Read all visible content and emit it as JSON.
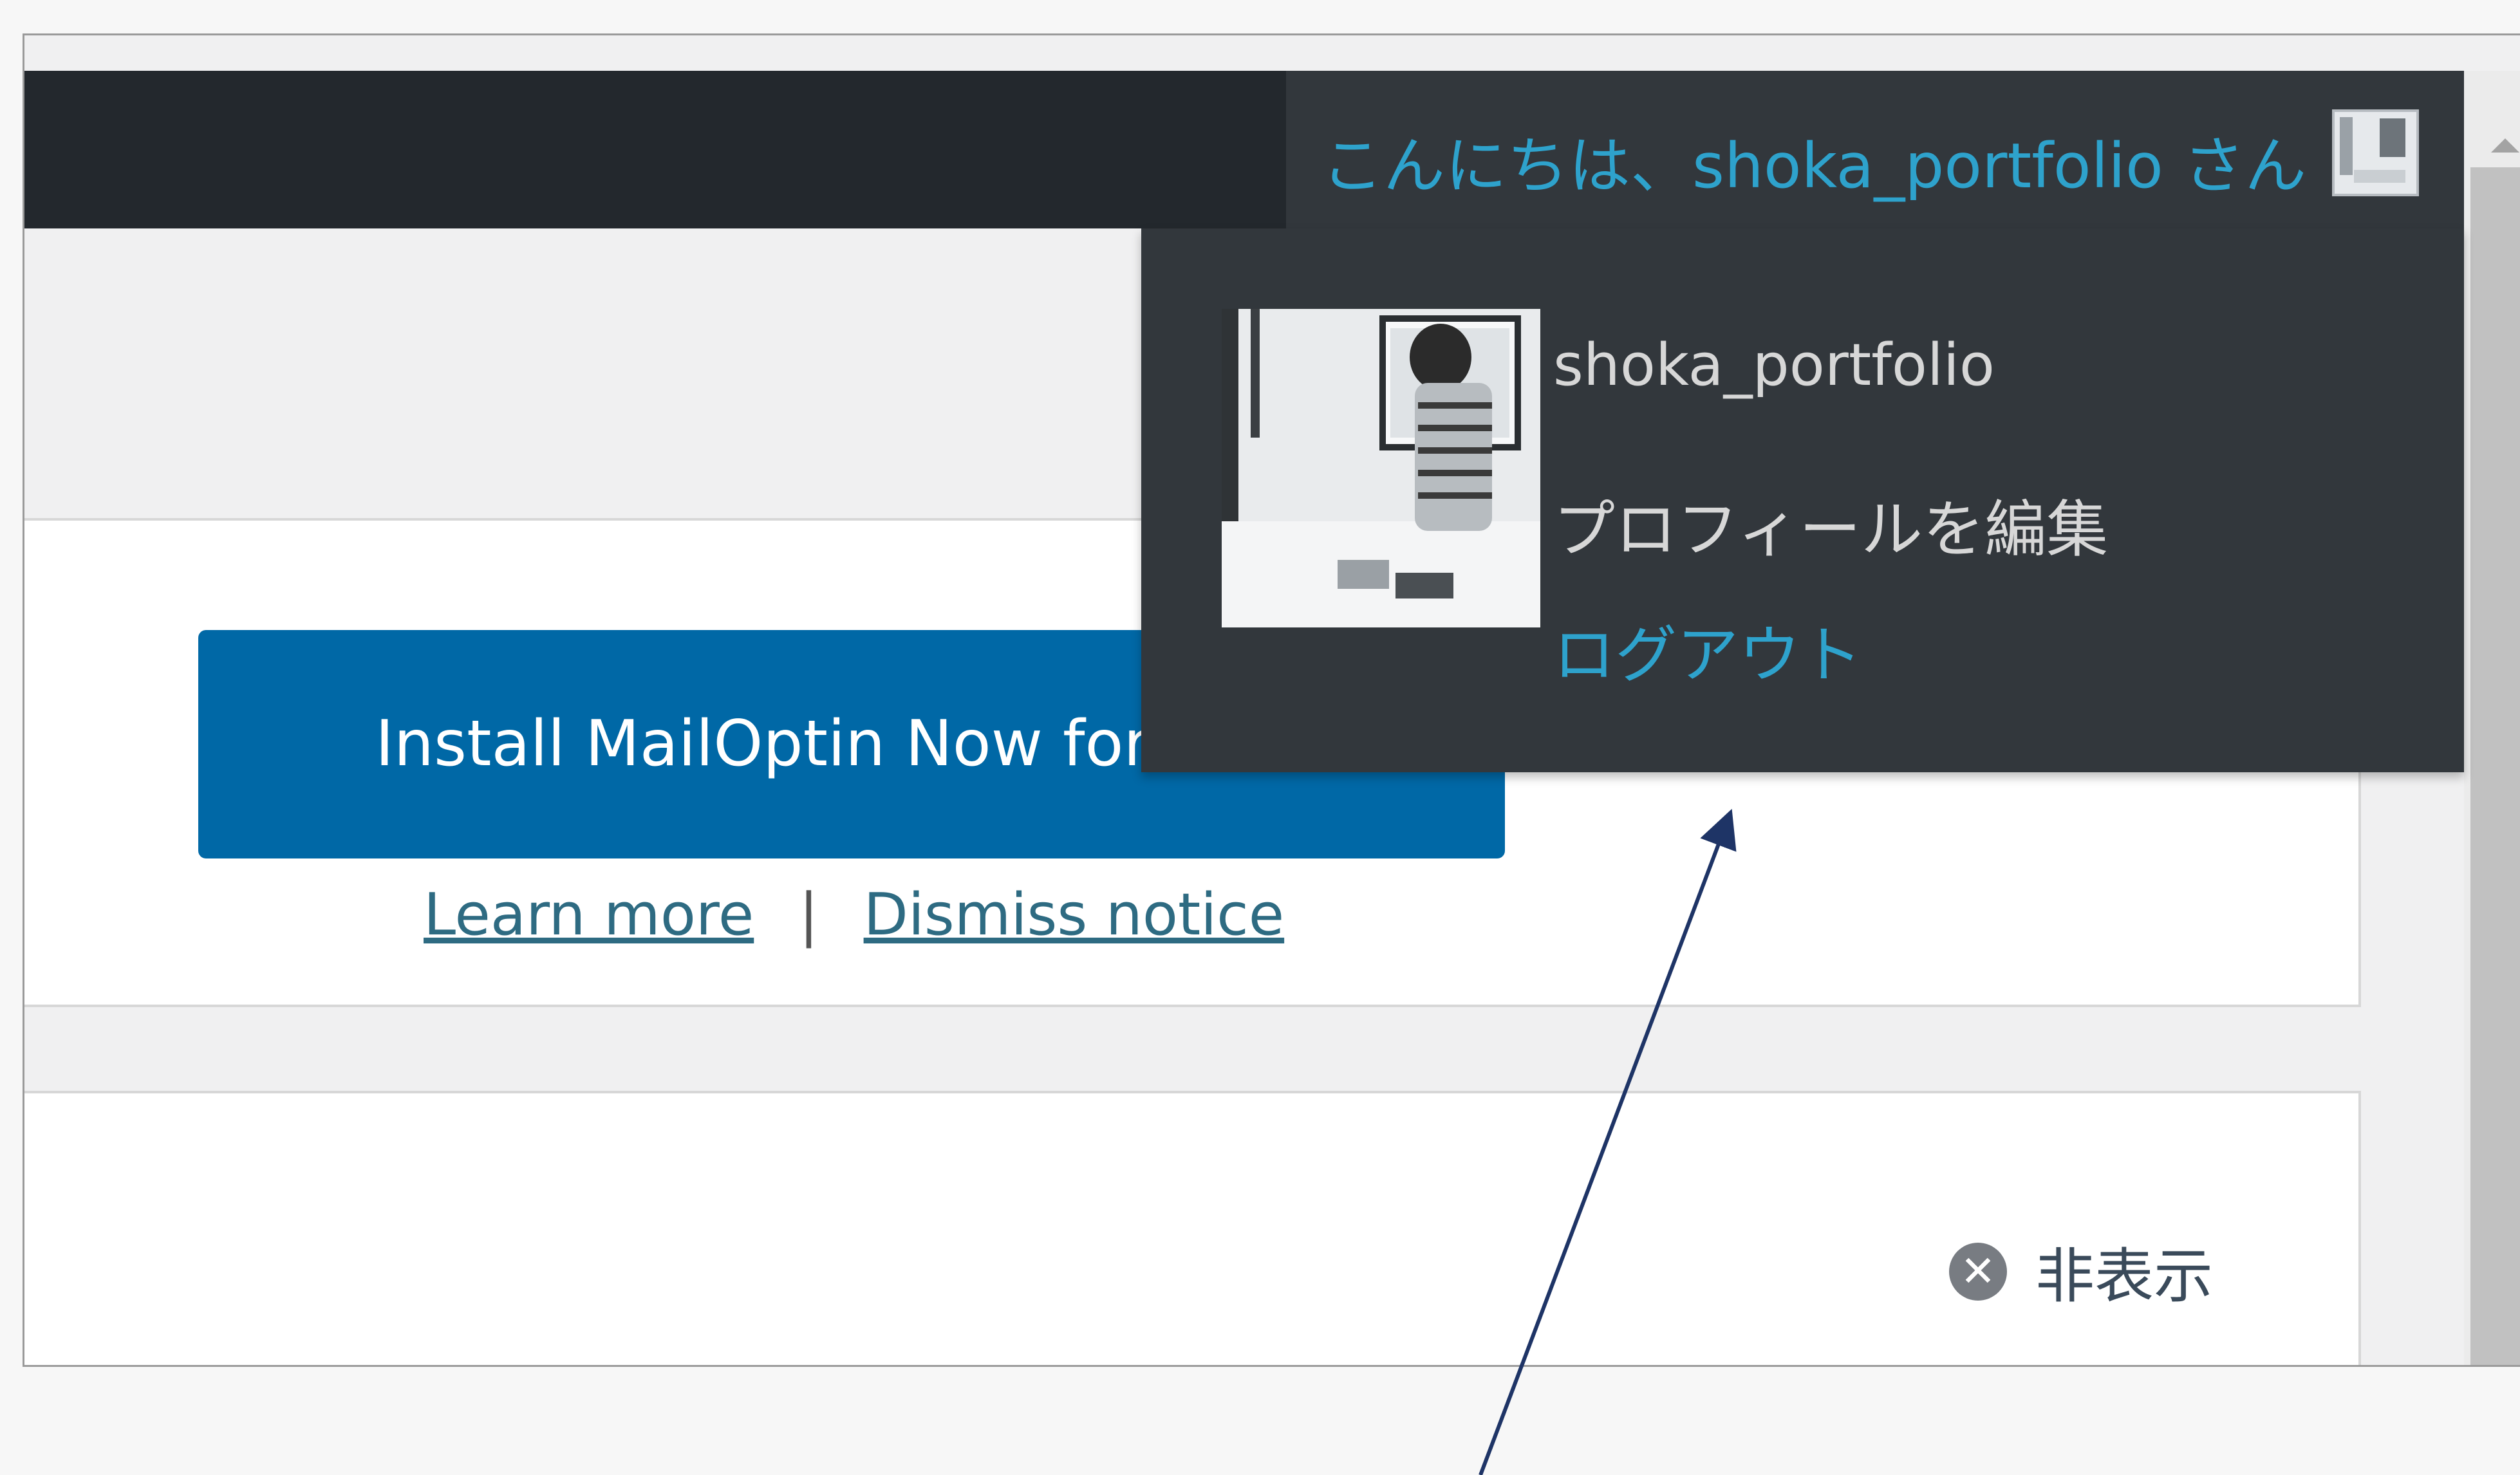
{
  "admin_bar": {
    "greeting": "こんにちは、shoka_portfolio さん"
  },
  "user_menu": {
    "username": "shoka_portfolio",
    "edit_profile": "プロフィールを編集",
    "logout": "ログアウト"
  },
  "notice": {
    "install_button": "Install MailOptin Now for Free",
    "learn_more": "Learn more",
    "separator": "|",
    "dismiss_notice": "Dismiss notice"
  },
  "panel": {
    "dismiss_label": "非表示"
  },
  "colors": {
    "admin_bar": "#23282d",
    "dropdown_bg": "#32373c",
    "link_blue": "#2ea2cc",
    "button_blue": "#0068a6",
    "annotation_arrow": "#1e3466"
  },
  "icons": {
    "dismiss": "close-circle-icon",
    "scroll_up": "scroll-up-arrow-icon"
  }
}
